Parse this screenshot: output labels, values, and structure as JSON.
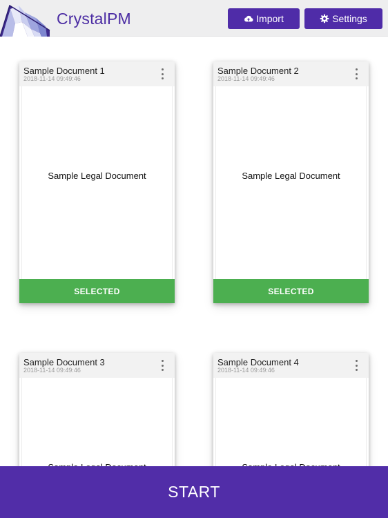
{
  "header": {
    "brand": "CrystalPM",
    "import_label": "Import",
    "settings_label": "Settings",
    "import_icon": "cloud-upload-icon",
    "settings_icon": "gear-icon"
  },
  "cards": [
    {
      "title": "Sample Document 1",
      "date": "2018-11-14 09:49:46",
      "preview": "Sample Legal Document",
      "status": "SELECTED"
    },
    {
      "title": "Sample Document 2",
      "date": "2018-11-14 09:49:46",
      "preview": "Sample Legal Document",
      "status": "SELECTED"
    },
    {
      "title": "Sample Document 3",
      "date": "2018-11-14 09:49:46",
      "preview": "Sample Legal Document"
    },
    {
      "title": "Sample Document 4",
      "date": "2018-11-14 09:49:46",
      "preview": "Sample Legal Document"
    }
  ],
  "footer": {
    "start_label": "START"
  },
  "colors": {
    "brand": "#4f2ca8",
    "selected": "#4caf50",
    "header_bg": "#eeeeef"
  }
}
